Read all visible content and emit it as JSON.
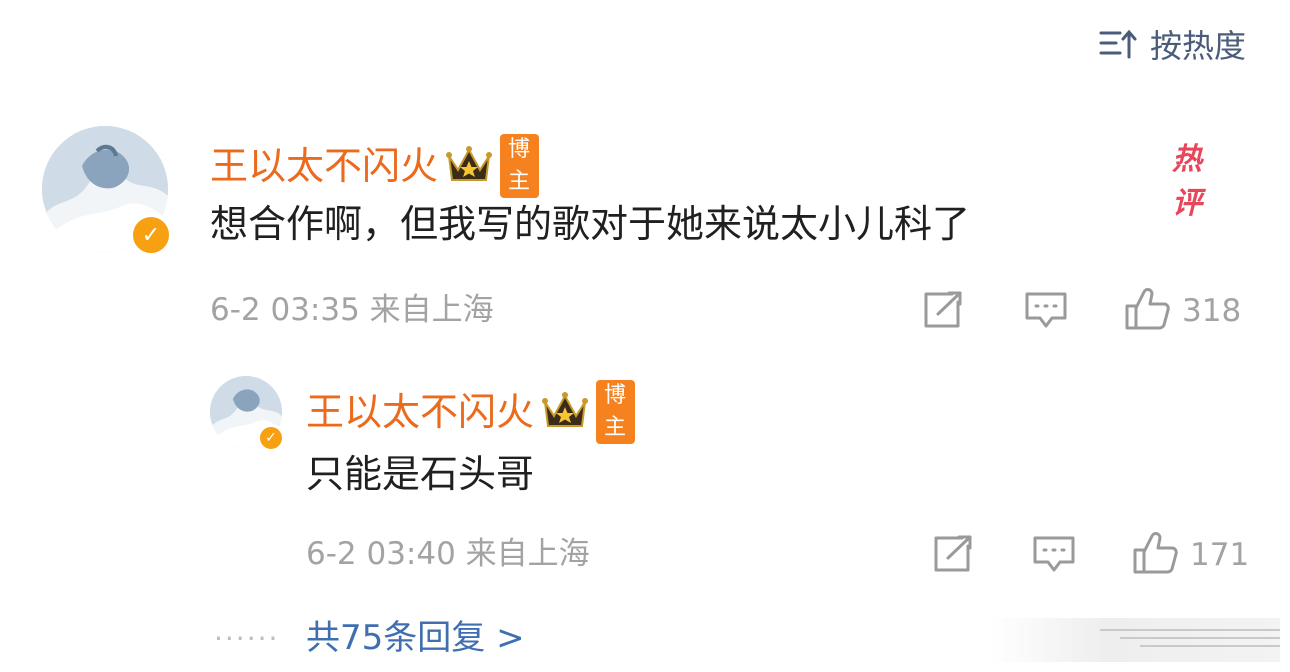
{
  "sort": {
    "label": "按热度"
  },
  "comment": {
    "user_name": "王以太不闪火",
    "badge_label": "博主",
    "hot_label": "热评",
    "text": "想合作啊，但我写的歌对于她来说太小儿科了",
    "meta": "6-2 03:35 来自上海",
    "likes": "318"
  },
  "reply": {
    "user_name": "王以太不闪火",
    "badge_label": "博主",
    "text": "只能是石头哥",
    "meta": "6-2 03:40 来自上海",
    "likes": "171"
  },
  "more_replies": {
    "dots": "······",
    "label": "共75条回复 >"
  },
  "colors": {
    "username": "#ec6a1c",
    "link": "#3f6fb0",
    "badge_bg": "#f6821f",
    "hot": "#e8465a",
    "meta": "#a3a3a3"
  },
  "icons": [
    "sort-icon",
    "crown-icon",
    "verified-icon",
    "repost-icon",
    "comment-icon",
    "like-icon"
  ]
}
